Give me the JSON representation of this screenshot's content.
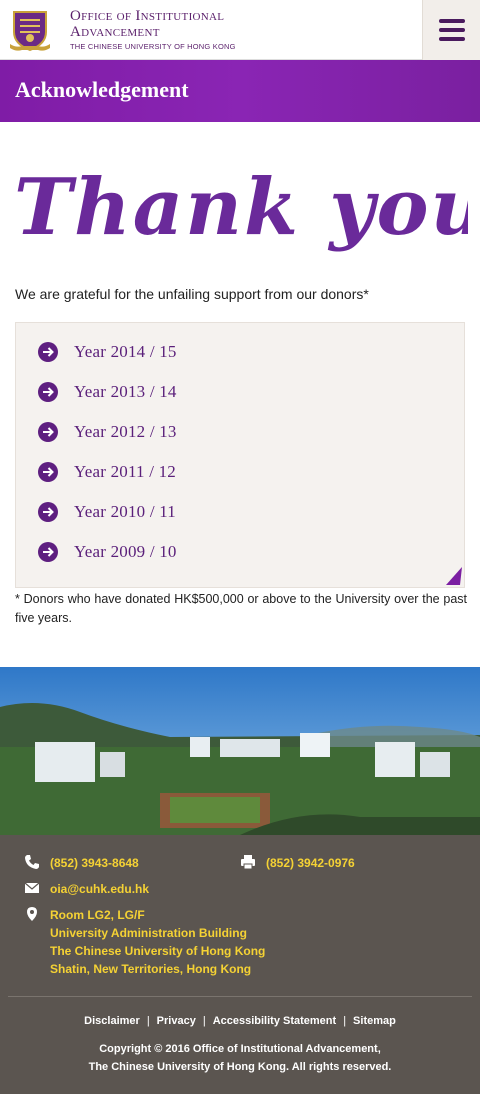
{
  "header": {
    "logo_line1": "Office of Institutional",
    "logo_line2": "Advancement",
    "logo_line3": "THE CHINESE UNIVERSITY OF HONG KONG",
    "menu_icon": "hamburger-menu-icon"
  },
  "banner": {
    "title": "Acknowledgement"
  },
  "thankyou": {
    "text": "Thank you!"
  },
  "intro": "We are grateful for the unfailing support from our donors*",
  "years": [
    {
      "label": "Year 2014 / 15"
    },
    {
      "label": "Year 2013 / 14"
    },
    {
      "label": "Year 2012 / 13"
    },
    {
      "label": "Year 2011 / 12"
    },
    {
      "label": "Year 2010 / 11"
    },
    {
      "label": "Year 2009 / 10"
    }
  ],
  "note": "* Donors who have donated HK$500,000 or above to the University over the past five years.",
  "footer": {
    "phone": "(852) 3943-8648",
    "fax": "(852) 3942-0976",
    "email": "oia@cuhk.edu.hk",
    "address": [
      "Room LG2, LG/F",
      "University Administration Building",
      "The Chinese University of Hong Kong",
      "Shatin, New Territories, Hong Kong"
    ],
    "links": [
      "Disclaimer",
      "Privacy",
      "Accessibility Statement",
      "Sitemap"
    ],
    "copyright_line1": "Copyright © 2016 Office of Institutional Advancement,",
    "copyright_line2": "The Chinese University of Hong Kong. All rights reserved."
  },
  "colors": {
    "brand_purple": "#7b1fa2",
    "link_purple": "#5a1f7a",
    "footer_bg": "#5b5550",
    "footer_text_yellow": "#f5d234"
  }
}
